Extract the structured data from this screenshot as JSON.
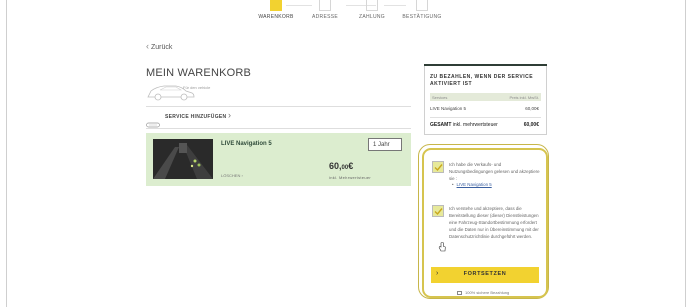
{
  "steps": [
    {
      "label": "WARENKORB",
      "active": true
    },
    {
      "label": "ADRESSE",
      "active": false
    },
    {
      "label": "ZAHLUNG",
      "active": false
    },
    {
      "label": "BESTÄTIGUNG",
      "active": false
    }
  ],
  "back_label": "Zurück",
  "page_title": "MEIN WARENKORB",
  "vehicle_label": "Für den vehicle",
  "add_service_label": "SERVICE HINZUFÜGEN",
  "cart_item": {
    "name": "LIVE Navigation 5",
    "duration": "1 Jahr",
    "price_main": "60,",
    "price_cents": "00",
    "price_currency": "€",
    "price_note": "inkl. Mehrwertsteuer",
    "delete_label": "LÖSCHEN"
  },
  "summary": {
    "title": "ZU BEZAHLEN, WENN DER SERVICE AKTIVIERT IST",
    "col_service": "Services",
    "col_price": "Preis inkl. MwSt.",
    "row_name": "LIVE Navigation 5",
    "row_price": "60,00€",
    "total_label": "GESAMT",
    "total_sub": "inkl. mehrwertsteuer",
    "total_value": "60,00€"
  },
  "terms": {
    "text_1": "Ich habe die Verkaufs- und Nutzungsbedingungen gelesen und akzeptiere sie :",
    "link_1": "LIVE Navigation 5",
    "text_2": "Ich verstehe und akzeptiere, dass die Bereitstellung dieser (dieser) Dienstleistungen eine Fahrzeug-Standortbestimmung erfordert und die Daten nur in Übereinstimmung mit der Datenschutzrichtlinie durchgeführt werden.",
    "continue_label": "FORTSETZEN",
    "secure_label": "100% sichere Bezahlung"
  },
  "colors": {
    "accent_yellow": "#f2d230",
    "product_bg": "#dcedcf",
    "checkbox_bg": "#e7e99a",
    "highlight_border": "#d6c44f"
  }
}
